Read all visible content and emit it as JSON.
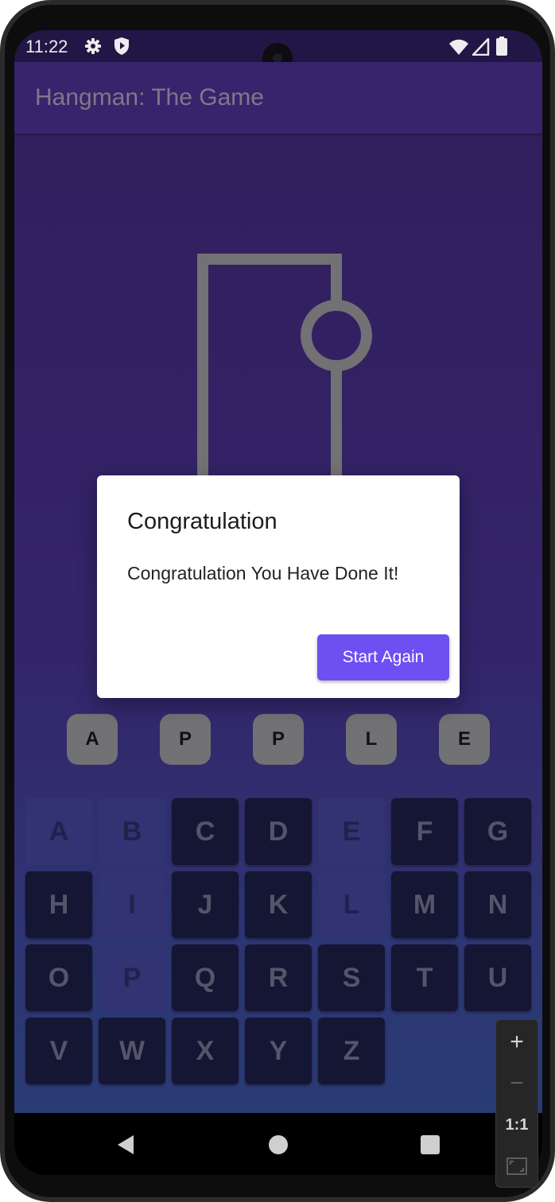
{
  "status": {
    "time": "11:22"
  },
  "app": {
    "title": "Hangman: The Game"
  },
  "dialog": {
    "title": "Congratulation",
    "message": "Congratulation You Have Done It!",
    "button_label": "Start Again"
  },
  "word": [
    "A",
    "P",
    "P",
    "L",
    "E"
  ],
  "keyboard": {
    "rows": [
      [
        {
          "letter": "A",
          "used": true
        },
        {
          "letter": "B",
          "used": true
        },
        {
          "letter": "C",
          "used": false
        },
        {
          "letter": "D",
          "used": false
        },
        {
          "letter": "E",
          "used": true
        },
        {
          "letter": "F",
          "used": false
        },
        {
          "letter": "G",
          "used": false
        }
      ],
      [
        {
          "letter": "H",
          "used": false
        },
        {
          "letter": "I",
          "used": true
        },
        {
          "letter": "J",
          "used": false
        },
        {
          "letter": "K",
          "used": false
        },
        {
          "letter": "L",
          "used": true
        },
        {
          "letter": "M",
          "used": false
        },
        {
          "letter": "N",
          "used": false
        }
      ],
      [
        {
          "letter": "O",
          "used": false
        },
        {
          "letter": "P",
          "used": true
        },
        {
          "letter": "Q",
          "used": false
        },
        {
          "letter": "R",
          "used": false
        },
        {
          "letter": "S",
          "used": false
        },
        {
          "letter": "T",
          "used": false
        },
        {
          "letter": "U",
          "used": false
        }
      ],
      [
        {
          "letter": "V",
          "used": false
        },
        {
          "letter": "W",
          "used": false
        },
        {
          "letter": "X",
          "used": false
        },
        {
          "letter": "Y",
          "used": false
        },
        {
          "letter": "Z",
          "used": false
        }
      ]
    ]
  },
  "zoom_controls": {
    "zoom_in": "+",
    "zoom_out": "−",
    "ratio": "1:1"
  },
  "colors": {
    "accent": "#6e4ff2",
    "app_bar": "#3a2672",
    "key_active": "#141735",
    "key_used": "#35377a",
    "word_tile": "#7a7a7a"
  }
}
